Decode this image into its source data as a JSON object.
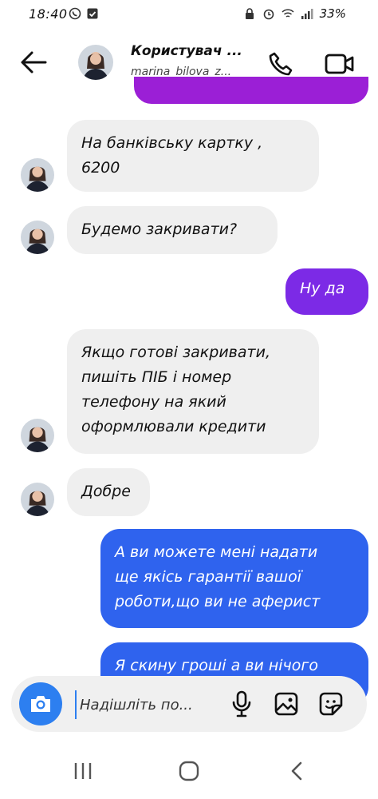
{
  "status_bar": {
    "time": "18:40",
    "battery": "33%"
  },
  "header": {
    "name": "Користувач ...",
    "username": "marina_bilova_z..."
  },
  "messages": [
    {
      "direction": "in",
      "text_line1": "На банківську картку ,",
      "text_line2": "6200"
    },
    {
      "direction": "in",
      "text": "Будемо закривати?"
    },
    {
      "direction": "out",
      "text": "Ну да"
    },
    {
      "direction": "in",
      "lines": [
        "Якщо готові закривати,",
        "пишіть ПІБ і номер",
        "телефону на який",
        "оформлювали кредити"
      ]
    },
    {
      "direction": "in",
      "text": "Добре"
    },
    {
      "direction": "out",
      "lines": [
        "А ви можете мені надати",
        "ще якісь гарантії вашої",
        "роботи,що ви не аферист"
      ]
    },
    {
      "direction": "out",
      "text": "Я скину гроші а ви нічого"
    }
  ],
  "composer": {
    "placeholder": "Надішліть по..."
  },
  "colors": {
    "purple_bubble": "#7c2ae6",
    "blue_bubble": "#2f63ee",
    "incoming_bubble": "#efefef",
    "camera_button": "#2d7ff0"
  },
  "icons": [
    "back-arrow-icon",
    "phone-icon",
    "video-camera-icon",
    "camera-icon",
    "microphone-icon",
    "gallery-icon",
    "sticker-icon",
    "recent-apps-icon",
    "home-icon",
    "back-nav-icon"
  ]
}
